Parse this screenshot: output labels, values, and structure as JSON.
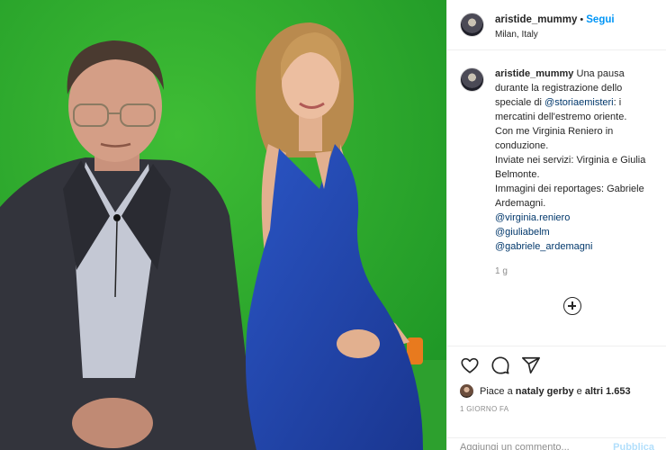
{
  "post": {
    "username": "aristide_mummy",
    "separator": "•",
    "follow_label": "Segui",
    "location": "Milan, Italy"
  },
  "caption": {
    "username": "aristide_mummy",
    "text_1": "Una pausa durante la registrazione dello speciale di",
    "mention_1": "@storiaemisteri",
    "text_2": ": i mercatini dell'estremo oriente.",
    "text_3": "Con me Virginia Reniero in conduzione.",
    "text_4": "Inviate nei servizi: Virginia e Giulia Belmonte.",
    "text_5": "Immagini dei reportages: Gabriele Ardemagni.",
    "mention_2": "@virginia.reniero",
    "mention_3": "@giuliabelm",
    "mention_4": "@gabriele_ardemagni",
    "time": "1 g"
  },
  "likes": {
    "prefix": "Piace a",
    "user": "nataly gerby",
    "middle": "e",
    "count": "altri 1.653"
  },
  "posted_ago": "1 GIORNO FA",
  "comment": {
    "placeholder": "Aggiungi un commento...",
    "publish_label": "Pubblica"
  },
  "icons": [
    "heart-icon",
    "comment-icon",
    "share-icon",
    "add-icon"
  ],
  "colors": {
    "link_blue": "#0095f6",
    "mention": "#00376b",
    "muted": "#8e8e8e",
    "green_screen": "#27a92b",
    "dress_blue": "#1d3fa0"
  }
}
